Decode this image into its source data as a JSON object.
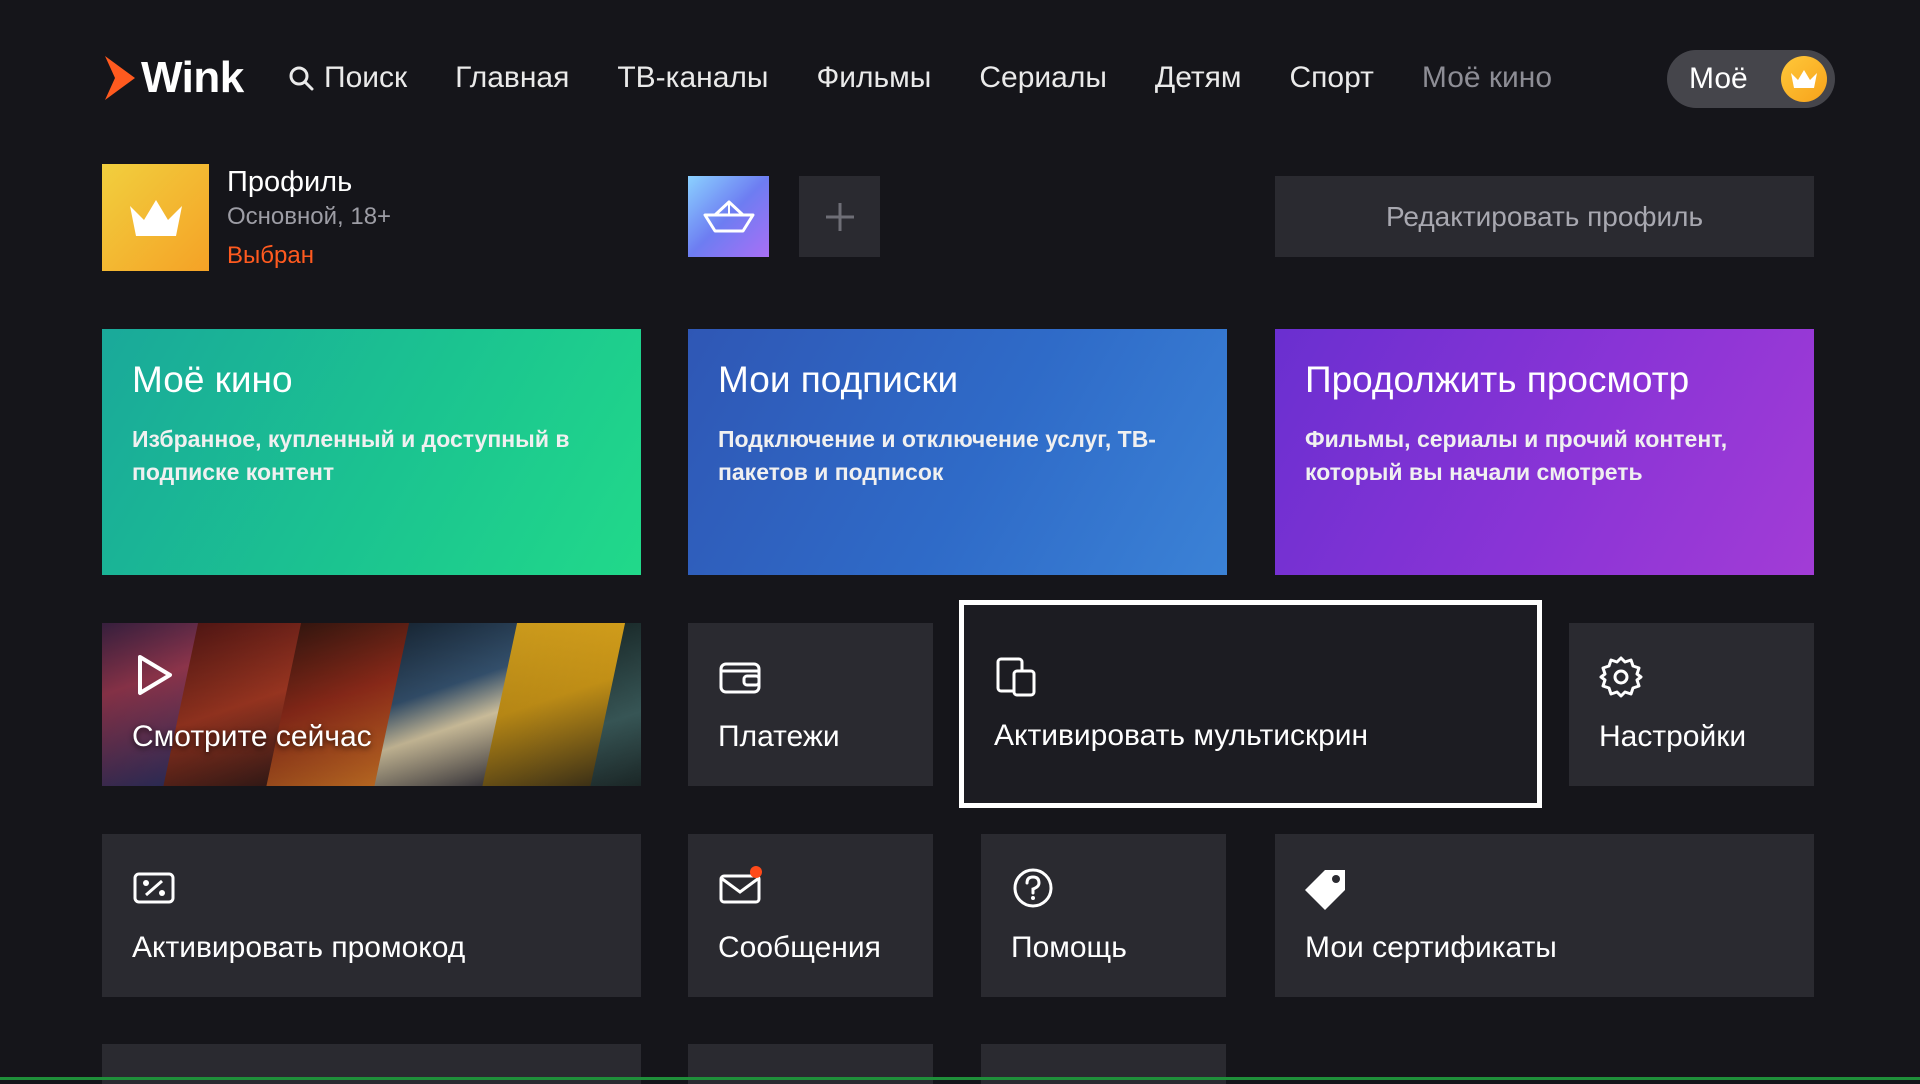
{
  "header": {
    "logo_text": "Wink",
    "search_label": "Поиск",
    "nav": [
      "Главная",
      "ТВ-каналы",
      "Фильмы",
      "Сериалы",
      "Детям",
      "Спорт",
      "Моё кино"
    ],
    "moe_label": "Моё"
  },
  "profile": {
    "name": "Профиль",
    "subtitle": "Основной, 18+",
    "status": "Выбран",
    "edit_label": "Редактировать профиль"
  },
  "cards": {
    "kino": {
      "title": "Моё кино",
      "desc": "Избранное, купленный и доступный в подписке контент"
    },
    "subs": {
      "title": "Мои подписки",
      "desc": "Подключение и отключение услуг, ТВ-пакетов и подписок"
    },
    "cont": {
      "title": "Продолжить просмотр",
      "desc": "Фильмы, сериалы и прочий контент, который вы начали смотреть"
    }
  },
  "tiles": {
    "watch_now": "Смотрите сейчас",
    "payments": "Платежи",
    "multiscreen": "Активировать мультискрин",
    "settings": "Настройки",
    "promo": "Активировать промокод",
    "messages": "Сообщения",
    "help": "Помощь",
    "certificates": "Мои сертификаты"
  },
  "colors": {
    "background": "#15151a",
    "tile": "#2a2a30",
    "accent_orange": "#ff5a1f",
    "crown_gold": "#f7b52a",
    "focus_outline": "#ffffff",
    "notification_dot": "#ff4a1a"
  },
  "icons": {
    "logo": "wink-logo-icon",
    "search": "search-icon",
    "crown": "crown-icon",
    "boat": "paper-boat-icon",
    "plus": "plus-icon",
    "play": "play-icon",
    "wallet": "wallet-icon",
    "devices": "devices-icon",
    "settings": "gear-icon",
    "promo": "promo-ticket-icon",
    "messages": "envelope-icon",
    "help": "question-icon",
    "certificate": "tag-icon"
  }
}
